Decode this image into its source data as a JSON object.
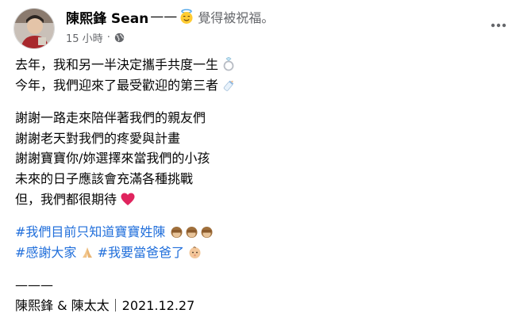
{
  "post": {
    "author": "陳熙鋒 Sean",
    "feeling_dash": "——",
    "feeling_emoji": "innocent-face-emoji",
    "feeling": "覺得被祝福。",
    "time": "15 小時",
    "separator": "·",
    "privacy_icon": "globe-icon",
    "more_icon": "more-options-icon"
  },
  "content": {
    "line1": "去年，我和另一半決定攜手共度一生",
    "line1_emoji": "ring-emoji",
    "line2": "今年，我們迎來了最受歡迎的第三者",
    "line2_emoji": "baby-bottle-emoji",
    "line3": "謝謝一路走來陪伴著我們的親友們",
    "line4": "謝謝老天對我們的疼愛與計畫",
    "line5": "謝謝寶寶你/妳選擇來當我們的小孩",
    "line6": "未來的日子應該會充滿各種挑戰",
    "line7": "但，我們都很期待",
    "line7_emoji": "red-heart-emoji",
    "hashtag1": "#我們目前只知道寶寶姓陳",
    "hashtag1_emojis": "see-no-evil-monkey-emoji x3",
    "hashtag2": "#感謝大家",
    "hashtag2_emoji": "folded-hands-emoji",
    "hashtag3": "#我要當爸爸了",
    "hashtag3_emoji": "baby-emoji",
    "divider": "———",
    "signature": "陳熙鋒 & 陳太太｜2021.12.27"
  },
  "colors": {
    "text": "#050505",
    "secondary": "#65676b",
    "hashtag": "#216fdb",
    "heart": "#e0245e"
  }
}
